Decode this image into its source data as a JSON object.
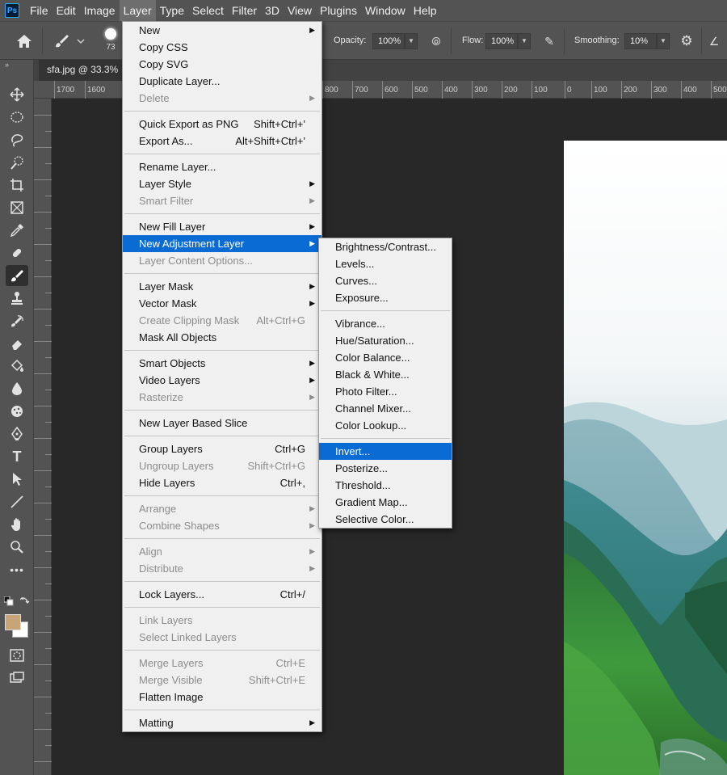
{
  "app": {
    "logo_text": "Ps"
  },
  "menubar": {
    "items": [
      "File",
      "Edit",
      "Image",
      "Layer",
      "Type",
      "Select",
      "Filter",
      "3D",
      "View",
      "Plugins",
      "Window",
      "Help"
    ],
    "active": "Layer"
  },
  "options": {
    "brush_size": "73",
    "opacity_label": "Opacity:",
    "opacity_value": "100%",
    "flow_label": "Flow:",
    "flow_value": "100%",
    "smoothing_label": "Smoothing:",
    "smoothing_value": "10%"
  },
  "document": {
    "tab_title": "sfa.jpg @ 33.3%",
    "ruler_ticks": [
      "1700",
      "1600",
      "800",
      "700",
      "600",
      "500",
      "400",
      "300",
      "200",
      "100",
      "0",
      "100",
      "200",
      "300",
      "400",
      "500"
    ],
    "ruler_ticks_right": [
      "800",
      "700",
      "600",
      "500",
      "400",
      "300",
      "200",
      "100",
      "0",
      "100",
      "200",
      "300",
      "400",
      "500"
    ],
    "ruler_ticks_left": [
      "1700",
      "1600"
    ]
  },
  "colors": {
    "foreground": "#c7a579",
    "background": "#ffffff",
    "menu_highlight": "#0a6bd4"
  },
  "layer_menu": {
    "groups": [
      [
        {
          "label": "New",
          "submenu": true
        },
        {
          "label": "Copy CSS"
        },
        {
          "label": "Copy SVG"
        },
        {
          "label": "Duplicate Layer..."
        },
        {
          "label": "Delete",
          "submenu": true,
          "disabled": true
        }
      ],
      [
        {
          "label": "Quick Export as PNG",
          "shortcut": "Shift+Ctrl+'"
        },
        {
          "label": "Export As...",
          "shortcut": "Alt+Shift+Ctrl+'"
        }
      ],
      [
        {
          "label": "Rename Layer..."
        },
        {
          "label": "Layer Style",
          "submenu": true
        },
        {
          "label": "Smart Filter",
          "submenu": true,
          "disabled": true
        }
      ],
      [
        {
          "label": "New Fill Layer",
          "submenu": true
        },
        {
          "label": "New Adjustment Layer",
          "submenu": true,
          "highlight": true
        },
        {
          "label": "Layer Content Options...",
          "disabled": true
        }
      ],
      [
        {
          "label": "Layer Mask",
          "submenu": true
        },
        {
          "label": "Vector Mask",
          "submenu": true
        },
        {
          "label": "Create Clipping Mask",
          "shortcut": "Alt+Ctrl+G",
          "disabled": true
        },
        {
          "label": "Mask All Objects"
        }
      ],
      [
        {
          "label": "Smart Objects",
          "submenu": true
        },
        {
          "label": "Video Layers",
          "submenu": true
        },
        {
          "label": "Rasterize",
          "submenu": true,
          "disabled": true
        }
      ],
      [
        {
          "label": "New Layer Based Slice"
        }
      ],
      [
        {
          "label": "Group Layers",
          "shortcut": "Ctrl+G"
        },
        {
          "label": "Ungroup Layers",
          "shortcut": "Shift+Ctrl+G",
          "disabled": true
        },
        {
          "label": "Hide Layers",
          "shortcut": "Ctrl+,"
        }
      ],
      [
        {
          "label": "Arrange",
          "submenu": true,
          "disabled": true
        },
        {
          "label": "Combine Shapes",
          "submenu": true,
          "disabled": true
        }
      ],
      [
        {
          "label": "Align",
          "submenu": true,
          "disabled": true
        },
        {
          "label": "Distribute",
          "submenu": true,
          "disabled": true
        }
      ],
      [
        {
          "label": "Lock Layers...",
          "shortcut": "Ctrl+/"
        }
      ],
      [
        {
          "label": "Link Layers",
          "disabled": true
        },
        {
          "label": "Select Linked Layers",
          "disabled": true
        }
      ],
      [
        {
          "label": "Merge Layers",
          "shortcut": "Ctrl+E",
          "disabled": true
        },
        {
          "label": "Merge Visible",
          "shortcut": "Shift+Ctrl+E",
          "disabled": true
        },
        {
          "label": "Flatten Image"
        }
      ],
      [
        {
          "label": "Matting",
          "submenu": true
        }
      ]
    ]
  },
  "adjustment_menu": {
    "groups": [
      [
        {
          "label": "Brightness/Contrast..."
        },
        {
          "label": "Levels..."
        },
        {
          "label": "Curves..."
        },
        {
          "label": "Exposure..."
        }
      ],
      [
        {
          "label": "Vibrance..."
        },
        {
          "label": "Hue/Saturation..."
        },
        {
          "label": "Color Balance..."
        },
        {
          "label": "Black & White..."
        },
        {
          "label": "Photo Filter..."
        },
        {
          "label": "Channel Mixer..."
        },
        {
          "label": "Color Lookup..."
        }
      ],
      [
        {
          "label": "Invert...",
          "highlight": true
        },
        {
          "label": "Posterize..."
        },
        {
          "label": "Threshold..."
        },
        {
          "label": "Gradient Map..."
        },
        {
          "label": "Selective Color..."
        }
      ]
    ]
  }
}
